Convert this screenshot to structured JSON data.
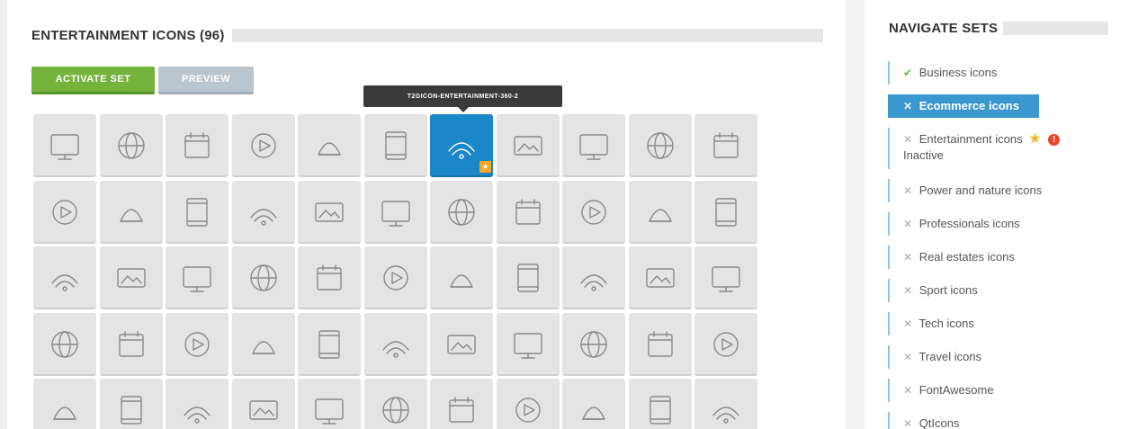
{
  "main": {
    "title": "ENTERTAINMENT ICONS (96)",
    "activate_label": "ACTIVATE SET",
    "preview_label": "PREVIEW",
    "tooltip": "T2GICON-ENTERTAINMENT-360-2",
    "accent_color": "#1b86c8",
    "selected_tile": "360-vr-icon",
    "grid_rows": [
      [
        "3d-icon",
        "vr-headset-icon",
        "4k-monitor-icon",
        "4k-tv-icon",
        "globe-360-icon",
        "rotate-360-icon",
        "360-vr-icon",
        "camera-360-icon",
        "view-360-icon",
        "arrows-expand-icon",
        "basketball-icon"
      ],
      [
        "balloons-icon",
        "barbecue-icon",
        "calendar-check-icon",
        "calendar-icon",
        "movie-camera-icon",
        "camera-rotate-icon",
        "panorama-icon",
        "globe-image-icon",
        "playing-cards-icon",
        "director-chair-icon",
        "chef-hat-icon"
      ],
      [
        "clapperboard-icon",
        "cinema-screen-icon",
        "circus-tent-icon",
        "cube-rotate-icon",
        "disc-touch-icon",
        "desktop-monitor-icon",
        "stage-light-icon",
        "film-strip-icon",
        "film-reel-icon",
        "video-player-icon",
        "campfire-icon"
      ],
      [
        "bunting-icon",
        "3d-glasses-icon",
        "electric-guitar-icon",
        "hd-monitor-icon",
        "laurel-stars-icon",
        "magic-hat-rabbit-icon",
        "theater-masks-icon",
        "phone-rotate-icon",
        "mobile-app-icon",
        "monitor-icon",
        "monitor-click-icon"
      ],
      [
        "touch-screen-icon",
        "certificate-icon",
        "wifi-monitor-icon",
        "museum-icon",
        "picture-frame-icon",
        "party-popper-icon",
        "picnic-wine-icon",
        "presentation-icon",
        "play-circle-icon",
        "video-progress-icon",
        "vr-goggles-icon"
      ]
    ]
  },
  "sidebar": {
    "title": "NAVIGATE SETS",
    "items": [
      {
        "label": "Business icons",
        "mark": "✔"
      },
      {
        "label": "Ecommerce icons",
        "mark": "✕"
      },
      {
        "label": "Entertainment icons",
        "mark": "✕",
        "sub": "Inactive"
      },
      {
        "label": "Power and nature icons",
        "mark": "✕"
      },
      {
        "label": "Professionals icons",
        "mark": "✕"
      },
      {
        "label": "Real estates icons",
        "mark": "✕"
      },
      {
        "label": "Sport icons",
        "mark": "✕"
      },
      {
        "label": "Tech icons",
        "mark": "✕"
      },
      {
        "label": "Travel icons",
        "mark": "✕"
      },
      {
        "label": "FontAwesome",
        "mark": "✕"
      },
      {
        "label": "QtIcons",
        "mark": "✕"
      }
    ],
    "active_color": "#3a98cf"
  }
}
